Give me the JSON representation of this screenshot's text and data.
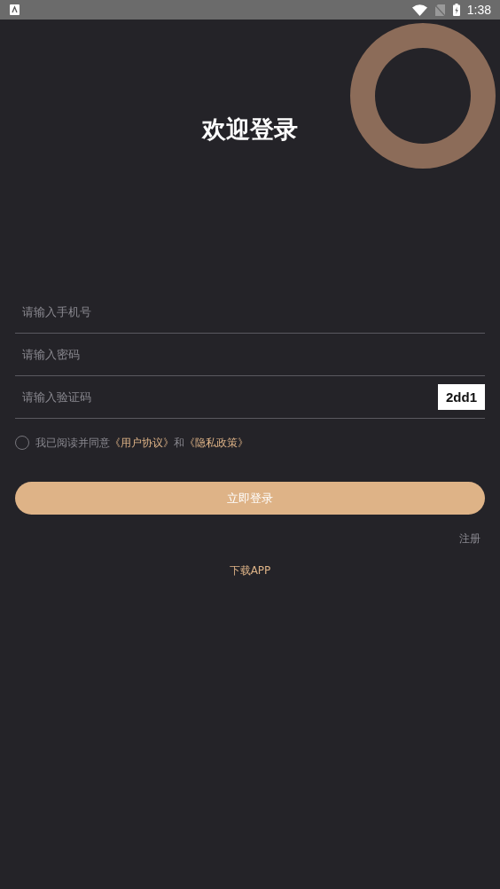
{
  "status_bar": {
    "time": "1:38"
  },
  "title": "欢迎登录",
  "fields": [
    {
      "placeholder": "请输入手机号",
      "kind": "text"
    },
    {
      "placeholder": "请输入密码",
      "kind": "password"
    },
    {
      "placeholder": "请输入验证码",
      "kind": "captcha",
      "captcha": "2dd1"
    }
  ],
  "agreement": {
    "checked": false,
    "parts": [
      {
        "text": "我已阅读并同意",
        "kind": "plain"
      },
      {
        "text": "《用户协议》",
        "kind": "link"
      },
      {
        "text": "和",
        "kind": "plain"
      },
      {
        "text": "《隐私政策》",
        "kind": "link"
      }
    ]
  },
  "login_button": "立即登录",
  "register_link": "注册",
  "download_link": "下载APP"
}
